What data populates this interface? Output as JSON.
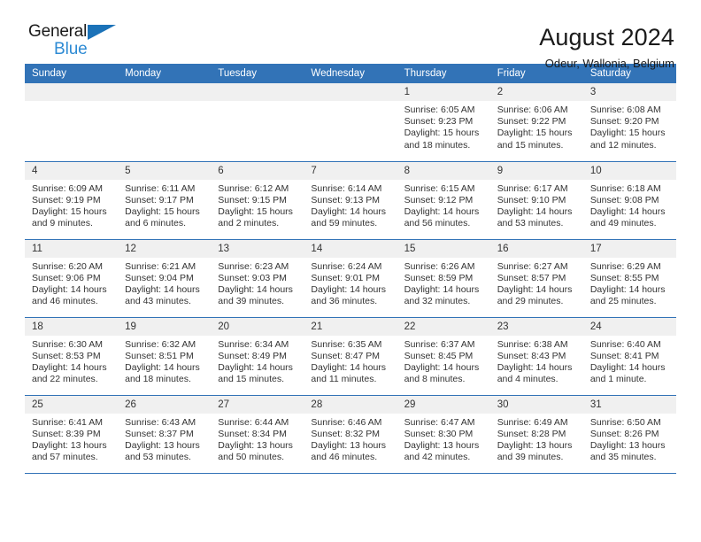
{
  "brand": {
    "name_top": "General",
    "name_bottom": "Blue",
    "accent_color": "#2e8bd4",
    "triangle_color": "#1b72b8"
  },
  "header": {
    "title": "August 2024",
    "subtitle": "Odeur, Wallonia, Belgium"
  },
  "calendar": {
    "header_bg": "#3273b7",
    "daynum_bg": "#f0f0f0",
    "weekdays": [
      "Sunday",
      "Monday",
      "Tuesday",
      "Wednesday",
      "Thursday",
      "Friday",
      "Saturday"
    ],
    "weeks": [
      [
        {
          "day": "",
          "sunrise": "",
          "sunset": "",
          "daylight": "",
          "daylight2": ""
        },
        {
          "day": "",
          "sunrise": "",
          "sunset": "",
          "daylight": "",
          "daylight2": ""
        },
        {
          "day": "",
          "sunrise": "",
          "sunset": "",
          "daylight": "",
          "daylight2": ""
        },
        {
          "day": "",
          "sunrise": "",
          "sunset": "",
          "daylight": "",
          "daylight2": ""
        },
        {
          "day": "1",
          "sunrise": "Sunrise: 6:05 AM",
          "sunset": "Sunset: 9:23 PM",
          "daylight": "Daylight: 15 hours",
          "daylight2": "and 18 minutes."
        },
        {
          "day": "2",
          "sunrise": "Sunrise: 6:06 AM",
          "sunset": "Sunset: 9:22 PM",
          "daylight": "Daylight: 15 hours",
          "daylight2": "and 15 minutes."
        },
        {
          "day": "3",
          "sunrise": "Sunrise: 6:08 AM",
          "sunset": "Sunset: 9:20 PM",
          "daylight": "Daylight: 15 hours",
          "daylight2": "and 12 minutes."
        }
      ],
      [
        {
          "day": "4",
          "sunrise": "Sunrise: 6:09 AM",
          "sunset": "Sunset: 9:19 PM",
          "daylight": "Daylight: 15 hours",
          "daylight2": "and 9 minutes."
        },
        {
          "day": "5",
          "sunrise": "Sunrise: 6:11 AM",
          "sunset": "Sunset: 9:17 PM",
          "daylight": "Daylight: 15 hours",
          "daylight2": "and 6 minutes."
        },
        {
          "day": "6",
          "sunrise": "Sunrise: 6:12 AM",
          "sunset": "Sunset: 9:15 PM",
          "daylight": "Daylight: 15 hours",
          "daylight2": "and 2 minutes."
        },
        {
          "day": "7",
          "sunrise": "Sunrise: 6:14 AM",
          "sunset": "Sunset: 9:13 PM",
          "daylight": "Daylight: 14 hours",
          "daylight2": "and 59 minutes."
        },
        {
          "day": "8",
          "sunrise": "Sunrise: 6:15 AM",
          "sunset": "Sunset: 9:12 PM",
          "daylight": "Daylight: 14 hours",
          "daylight2": "and 56 minutes."
        },
        {
          "day": "9",
          "sunrise": "Sunrise: 6:17 AM",
          "sunset": "Sunset: 9:10 PM",
          "daylight": "Daylight: 14 hours",
          "daylight2": "and 53 minutes."
        },
        {
          "day": "10",
          "sunrise": "Sunrise: 6:18 AM",
          "sunset": "Sunset: 9:08 PM",
          "daylight": "Daylight: 14 hours",
          "daylight2": "and 49 minutes."
        }
      ],
      [
        {
          "day": "11",
          "sunrise": "Sunrise: 6:20 AM",
          "sunset": "Sunset: 9:06 PM",
          "daylight": "Daylight: 14 hours",
          "daylight2": "and 46 minutes."
        },
        {
          "day": "12",
          "sunrise": "Sunrise: 6:21 AM",
          "sunset": "Sunset: 9:04 PM",
          "daylight": "Daylight: 14 hours",
          "daylight2": "and 43 minutes."
        },
        {
          "day": "13",
          "sunrise": "Sunrise: 6:23 AM",
          "sunset": "Sunset: 9:03 PM",
          "daylight": "Daylight: 14 hours",
          "daylight2": "and 39 minutes."
        },
        {
          "day": "14",
          "sunrise": "Sunrise: 6:24 AM",
          "sunset": "Sunset: 9:01 PM",
          "daylight": "Daylight: 14 hours",
          "daylight2": "and 36 minutes."
        },
        {
          "day": "15",
          "sunrise": "Sunrise: 6:26 AM",
          "sunset": "Sunset: 8:59 PM",
          "daylight": "Daylight: 14 hours",
          "daylight2": "and 32 minutes."
        },
        {
          "day": "16",
          "sunrise": "Sunrise: 6:27 AM",
          "sunset": "Sunset: 8:57 PM",
          "daylight": "Daylight: 14 hours",
          "daylight2": "and 29 minutes."
        },
        {
          "day": "17",
          "sunrise": "Sunrise: 6:29 AM",
          "sunset": "Sunset: 8:55 PM",
          "daylight": "Daylight: 14 hours",
          "daylight2": "and 25 minutes."
        }
      ],
      [
        {
          "day": "18",
          "sunrise": "Sunrise: 6:30 AM",
          "sunset": "Sunset: 8:53 PM",
          "daylight": "Daylight: 14 hours",
          "daylight2": "and 22 minutes."
        },
        {
          "day": "19",
          "sunrise": "Sunrise: 6:32 AM",
          "sunset": "Sunset: 8:51 PM",
          "daylight": "Daylight: 14 hours",
          "daylight2": "and 18 minutes."
        },
        {
          "day": "20",
          "sunrise": "Sunrise: 6:34 AM",
          "sunset": "Sunset: 8:49 PM",
          "daylight": "Daylight: 14 hours",
          "daylight2": "and 15 minutes."
        },
        {
          "day": "21",
          "sunrise": "Sunrise: 6:35 AM",
          "sunset": "Sunset: 8:47 PM",
          "daylight": "Daylight: 14 hours",
          "daylight2": "and 11 minutes."
        },
        {
          "day": "22",
          "sunrise": "Sunrise: 6:37 AM",
          "sunset": "Sunset: 8:45 PM",
          "daylight": "Daylight: 14 hours",
          "daylight2": "and 8 minutes."
        },
        {
          "day": "23",
          "sunrise": "Sunrise: 6:38 AM",
          "sunset": "Sunset: 8:43 PM",
          "daylight": "Daylight: 14 hours",
          "daylight2": "and 4 minutes."
        },
        {
          "day": "24",
          "sunrise": "Sunrise: 6:40 AM",
          "sunset": "Sunset: 8:41 PM",
          "daylight": "Daylight: 14 hours",
          "daylight2": "and 1 minute."
        }
      ],
      [
        {
          "day": "25",
          "sunrise": "Sunrise: 6:41 AM",
          "sunset": "Sunset: 8:39 PM",
          "daylight": "Daylight: 13 hours",
          "daylight2": "and 57 minutes."
        },
        {
          "day": "26",
          "sunrise": "Sunrise: 6:43 AM",
          "sunset": "Sunset: 8:37 PM",
          "daylight": "Daylight: 13 hours",
          "daylight2": "and 53 minutes."
        },
        {
          "day": "27",
          "sunrise": "Sunrise: 6:44 AM",
          "sunset": "Sunset: 8:34 PM",
          "daylight": "Daylight: 13 hours",
          "daylight2": "and 50 minutes."
        },
        {
          "day": "28",
          "sunrise": "Sunrise: 6:46 AM",
          "sunset": "Sunset: 8:32 PM",
          "daylight": "Daylight: 13 hours",
          "daylight2": "and 46 minutes."
        },
        {
          "day": "29",
          "sunrise": "Sunrise: 6:47 AM",
          "sunset": "Sunset: 8:30 PM",
          "daylight": "Daylight: 13 hours",
          "daylight2": "and 42 minutes."
        },
        {
          "day": "30",
          "sunrise": "Sunrise: 6:49 AM",
          "sunset": "Sunset: 8:28 PM",
          "daylight": "Daylight: 13 hours",
          "daylight2": "and 39 minutes."
        },
        {
          "day": "31",
          "sunrise": "Sunrise: 6:50 AM",
          "sunset": "Sunset: 8:26 PM",
          "daylight": "Daylight: 13 hours",
          "daylight2": "and 35 minutes."
        }
      ]
    ]
  }
}
